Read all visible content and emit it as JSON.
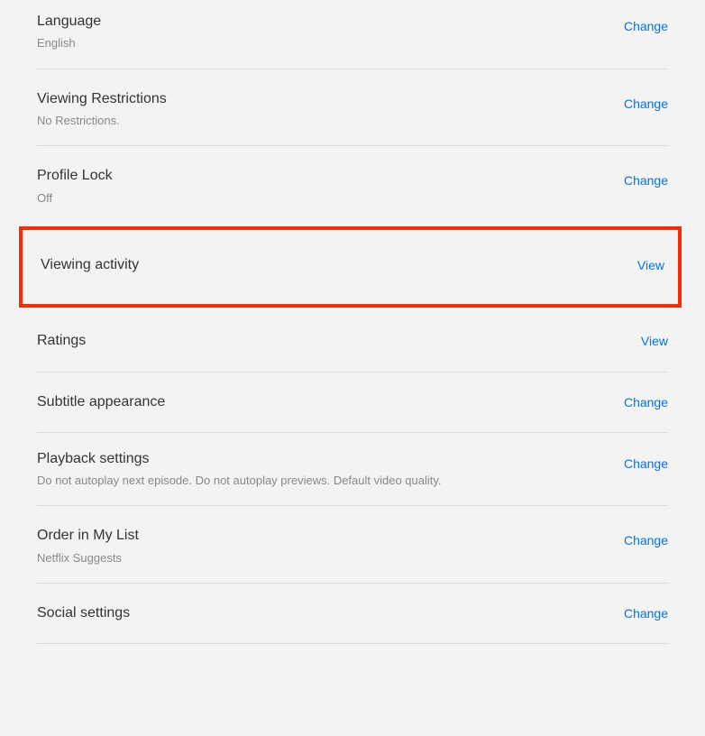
{
  "settings": {
    "language": {
      "title": "Language",
      "subtitle": "English",
      "action": "Change"
    },
    "viewingRestrictions": {
      "title": "Viewing Restrictions",
      "subtitle": "No Restrictions.",
      "action": "Change"
    },
    "profileLock": {
      "title": "Profile Lock",
      "subtitle": "Off",
      "action": "Change"
    },
    "viewingActivity": {
      "title": "Viewing activity",
      "action": "View"
    },
    "ratings": {
      "title": "Ratings",
      "action": "View"
    },
    "subtitleAppearance": {
      "title": "Subtitle appearance",
      "action": "Change"
    },
    "playbackSettings": {
      "title": "Playback settings",
      "subtitle": "Do not autoplay next episode. Do not autoplay previews. Default video quality.",
      "action": "Change"
    },
    "orderInMyList": {
      "title": "Order in My List",
      "subtitle": "Netflix Suggests",
      "action": "Change"
    },
    "socialSettings": {
      "title": "Social settings",
      "action": "Change"
    }
  }
}
